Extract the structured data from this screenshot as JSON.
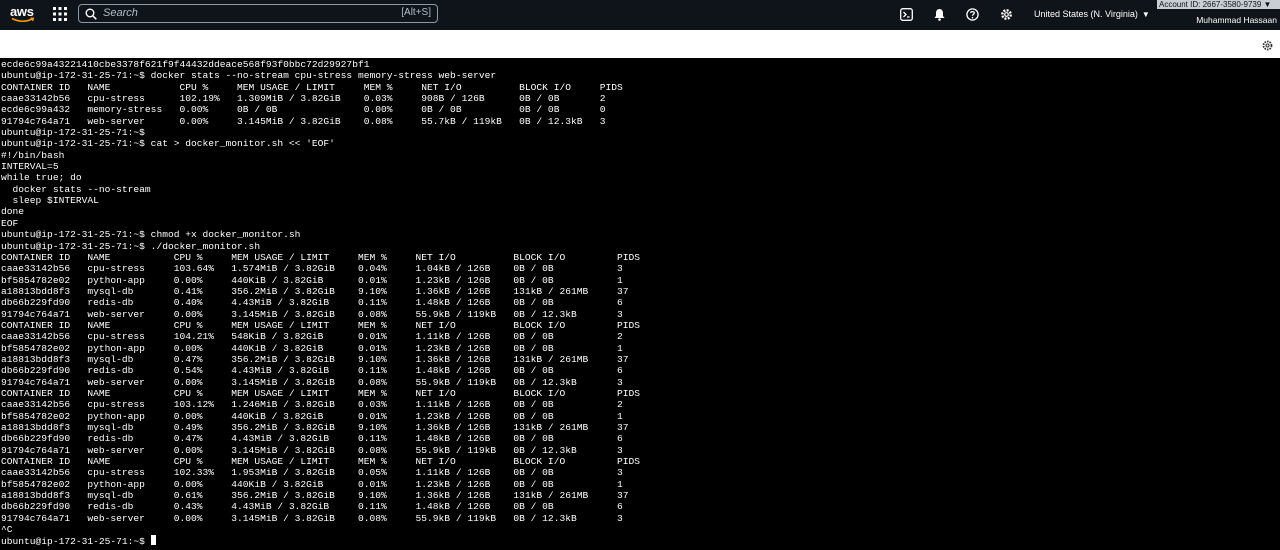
{
  "header": {
    "logo_text": "aws",
    "search_placeholder": "Search",
    "search_shortcut": "[Alt+S]",
    "region": "United States (N. Virginia)",
    "account_id": "Account ID: 2667-3580-9739",
    "user_name": "Muhammad Hassaan",
    "icons": [
      "cloudshell-icon",
      "bell-icon",
      "help-icon",
      "gear-icon"
    ]
  },
  "terminal": {
    "lines": [
      "ecde6c99a43221410cbe3378f621f9f44432ddeace568f93f0bbc72d29927bf1",
      "ubuntu@ip-172-31-25-71:~$ docker stats --no-stream cpu-stress memory-stress web-server",
      "CONTAINER ID   NAME            CPU %     MEM USAGE / LIMIT     MEM %     NET I/O          BLOCK I/O     PIDS",
      "caae33142b56   cpu-stress      102.19%   1.309MiB / 3.82GiB    0.03%     908B / 126B      0B / 0B       2",
      "ecde6c99a432   memory-stress   0.00%     0B / 0B               0.00%     0B / 0B          0B / 0B       0",
      "91794c764a71   web-server      0.00%     3.145MiB / 3.82GiB    0.08%     55.7kB / 119kB   0B / 12.3kB   3",
      "ubuntu@ip-172-31-25-71:~$",
      "ubuntu@ip-172-31-25-71:~$ cat > docker_monitor.sh << 'EOF'",
      "#!/bin/bash",
      "INTERVAL=5",
      "while true; do",
      "  docker stats --no-stream",
      "  sleep $INTERVAL",
      "done",
      "EOF",
      "ubuntu@ip-172-31-25-71:~$ chmod +x docker_monitor.sh",
      "ubuntu@ip-172-31-25-71:~$ ./docker_monitor.sh",
      "CONTAINER ID   NAME           CPU %     MEM USAGE / LIMIT     MEM %     NET I/O          BLOCK I/O         PIDS",
      "caae33142b56   cpu-stress     103.64%   1.574MiB / 3.82GiB    0.04%     1.04kB / 126B    0B / 0B           3",
      "bf5854782e02   python-app     0.00%     440KiB / 3.82GiB      0.01%     1.23kB / 126B    0B / 0B           1",
      "a18813bdd8f3   mysql-db       0.41%     356.2MiB / 3.82GiB    9.10%     1.36kB / 126B    131kB / 261MB     37",
      "db66b229fd90   redis-db       0.40%     4.43MiB / 3.82GiB     0.11%     1.48kB / 126B    0B / 0B           6",
      "91794c764a71   web-server     0.00%     3.145MiB / 3.82GiB    0.08%     55.9kB / 119kB   0B / 12.3kB       3",
      "CONTAINER ID   NAME           CPU %     MEM USAGE / LIMIT     MEM %     NET I/O          BLOCK I/O         PIDS",
      "caae33142b56   cpu-stress     104.21%   548KiB / 3.82GiB      0.01%     1.11kB / 126B    0B / 0B           2",
      "bf5854782e02   python-app     0.00%     440KiB / 3.82GiB      0.01%     1.23kB / 126B    0B / 0B           1",
      "a18813bdd8f3   mysql-db       0.47%     356.2MiB / 3.82GiB    9.10%     1.36kB / 126B    131kB / 261MB     37",
      "db66b229fd90   redis-db       0.54%     4.43MiB / 3.82GiB     0.11%     1.48kB / 126B    0B / 0B           6",
      "91794c764a71   web-server     0.00%     3.145MiB / 3.82GiB    0.08%     55.9kB / 119kB   0B / 12.3kB       3",
      "CONTAINER ID   NAME           CPU %     MEM USAGE / LIMIT     MEM %     NET I/O          BLOCK I/O         PIDS",
      "caae33142b56   cpu-stress     103.12%   1.246MiB / 3.82GiB    0.03%     1.11kB / 126B    0B / 0B           2",
      "bf5854782e02   python-app     0.00%     440KiB / 3.82GiB      0.01%     1.23kB / 126B    0B / 0B           1",
      "a18813bdd8f3   mysql-db       0.49%     356.2MiB / 3.82GiB    9.10%     1.36kB / 126B    131kB / 261MB     37",
      "db66b229fd90   redis-db       0.47%     4.43MiB / 3.82GiB     0.11%     1.48kB / 126B    0B / 0B           6",
      "91794c764a71   web-server     0.00%     3.145MiB / 3.82GiB    0.08%     55.9kB / 119kB   0B / 12.3kB       3",
      "CONTAINER ID   NAME           CPU %     MEM USAGE / LIMIT     MEM %     NET I/O          BLOCK I/O         PIDS",
      "caae33142b56   cpu-stress     102.33%   1.953MiB / 3.82GiB    0.05%     1.11kB / 126B    0B / 0B           3",
      "bf5854782e02   python-app     0.00%     440KiB / 3.82GiB      0.01%     1.23kB / 126B    0B / 0B           1",
      "a18813bdd8f3   mysql-db       0.61%     356.2MiB / 3.82GiB    9.10%     1.36kB / 126B    131kB / 261MB     37",
      "db66b229fd90   redis-db       0.43%     4.43MiB / 3.82GiB     0.11%     1.48kB / 126B    0B / 0B           6",
      "91794c764a71   web-server     0.00%     3.145MiB / 3.82GiB    0.08%     55.9kB / 119kB   0B / 12.3kB       3",
      "^C"
    ],
    "prompt": "ubuntu@ip-172-31-25-71:~$ "
  }
}
